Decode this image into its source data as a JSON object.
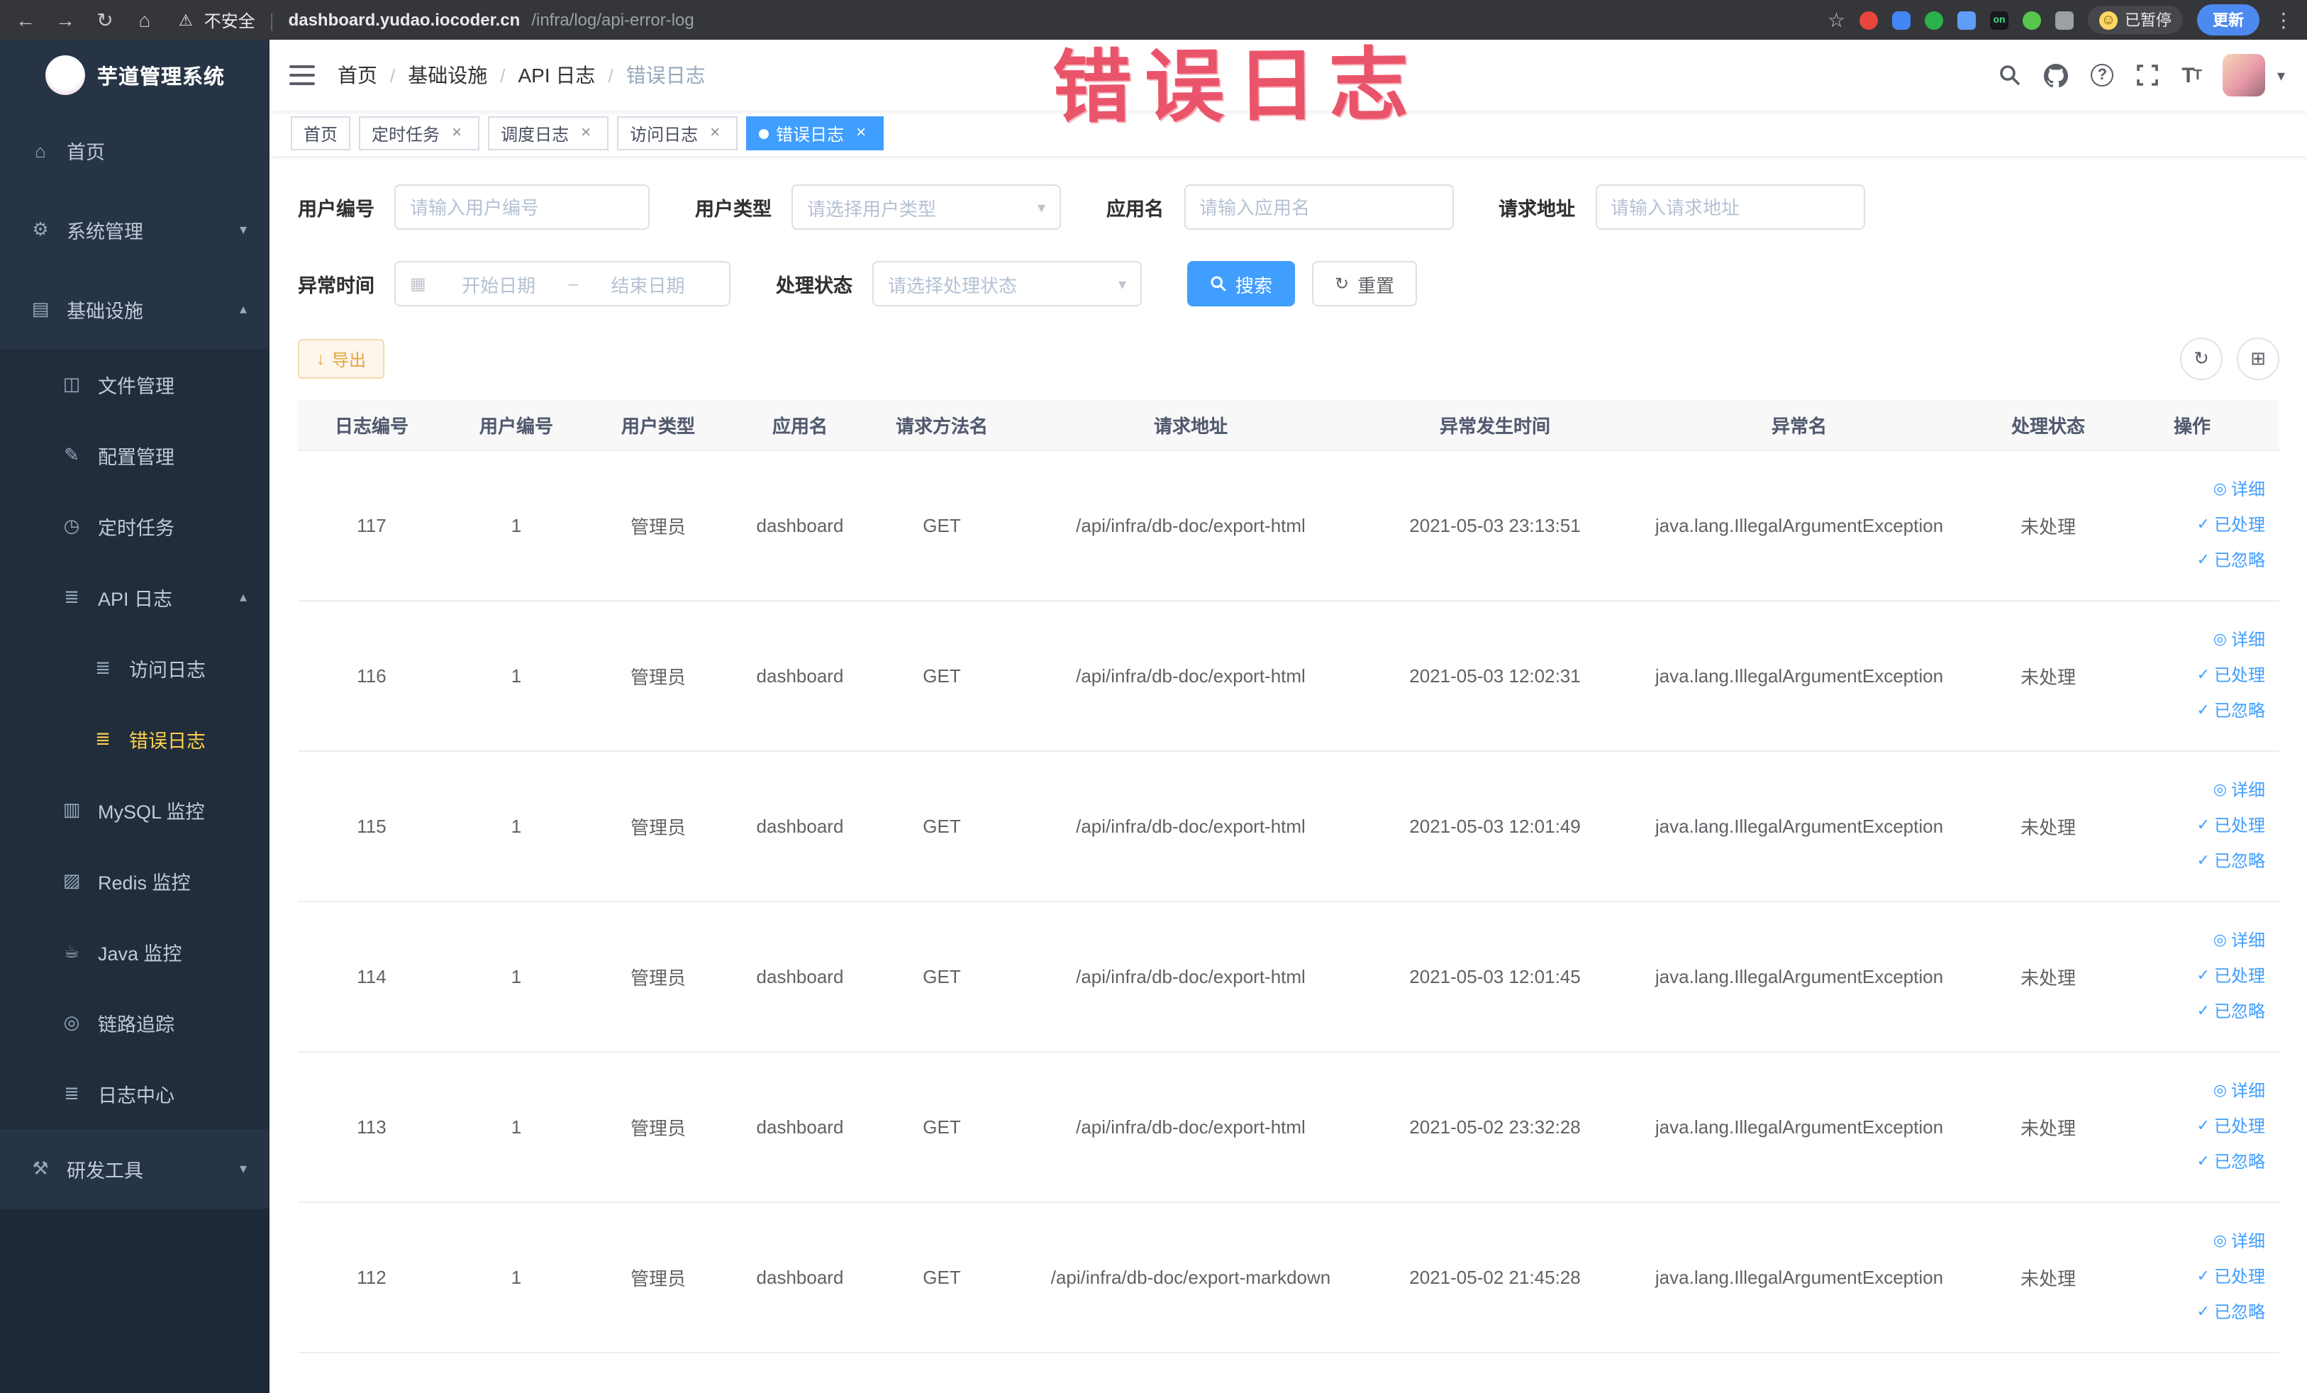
{
  "colors": {
    "accent": "#409eff",
    "warning_text": "#e6a23c",
    "sidebar_active_text": "#ffd04b",
    "watermark": "#e9485f",
    "link": "#409eff"
  },
  "icons": {
    "back": "←",
    "forward": "→",
    "reload": "↻",
    "home": "⌂",
    "warning": "⚠",
    "star": "☆",
    "kebab": "⋮",
    "divider": "|",
    "extension_on_text": "on",
    "smiley": "☺",
    "caret_down": "▾",
    "chevron_down": "▾",
    "chevron_up": "▴",
    "select_caret": "▾",
    "menu_home": "⌂",
    "menu_system": "⚙",
    "menu_infra": "▤",
    "menu_file": "◫",
    "menu_config": "✎",
    "menu_job": "◷",
    "menu_api": "≣",
    "menu_doc": "≣",
    "menu_mysql": "▥",
    "menu_redis": "▨",
    "menu_java": "☕",
    "menu_trace": "◎",
    "menu_log": "≣",
    "menu_tool": "⚒",
    "calendar": "▦",
    "range_sep": "–",
    "export": "↓",
    "refresh": "↻",
    "columns": "⊞",
    "eye": "◎",
    "check": "✓",
    "close": "×",
    "question": "?",
    "fontsize_big": "T",
    "fontsize_small": "T"
  },
  "browser": {
    "security_label": "不安全",
    "url_host": "dashboard.yudao.iocoder.cn",
    "url_path": "/infra/log/api-error-log",
    "paused_badge": "已暂停",
    "update_button": "更新"
  },
  "watermark": "错误日志",
  "sidebar": {
    "logo_title": "芋道管理系统",
    "items": [
      {
        "label": "首页"
      },
      {
        "label": "系统管理"
      },
      {
        "label": "基础设施"
      },
      {
        "label": "文件管理"
      },
      {
        "label": "配置管理"
      },
      {
        "label": "定时任务"
      },
      {
        "label": "API 日志"
      },
      {
        "label": "访问日志"
      },
      {
        "label": "错误日志"
      },
      {
        "label": "MySQL 监控"
      },
      {
        "label": "Redis 监控"
      },
      {
        "label": "Java 监控"
      },
      {
        "label": "链路追踪"
      },
      {
        "label": "日志中心"
      },
      {
        "label": "研发工具"
      }
    ]
  },
  "breadcrumb": {
    "separator": "/",
    "items": [
      "首页",
      "基础设施",
      "API 日志",
      "错误日志"
    ]
  },
  "tags": [
    {
      "label": "首页"
    },
    {
      "label": "定时任务"
    },
    {
      "label": "调度日志"
    },
    {
      "label": "访问日志"
    },
    {
      "label": "错误日志"
    }
  ],
  "filters": {
    "user_id": {
      "label": "用户编号",
      "placeholder": "请输入用户编号",
      "value": ""
    },
    "user_type": {
      "label": "用户类型",
      "placeholder": "请选择用户类型"
    },
    "app_name": {
      "label": "应用名",
      "placeholder": "请输入应用名",
      "value": ""
    },
    "request_url": {
      "label": "请求地址",
      "placeholder": "请输入请求地址",
      "value": ""
    },
    "exception_time": {
      "label": "异常时间",
      "start_placeholder": "开始日期",
      "end_placeholder": "结束日期"
    },
    "process_status": {
      "label": "处理状态",
      "placeholder": "请选择处理状态"
    },
    "search_button": "搜索",
    "reset_button": "重置"
  },
  "toolbar": {
    "export_button": "导出"
  },
  "table": {
    "columns": [
      "日志编号",
      "用户编号",
      "用户类型",
      "应用名",
      "请求方法名",
      "请求地址",
      "异常发生时间",
      "异常名",
      "处理状态",
      "操作"
    ],
    "actions": {
      "detail": "详细",
      "processed": "已处理",
      "ignored": "已忽略"
    },
    "rows": [
      {
        "log_id": "117",
        "user_id": "1",
        "user_type": "管理员",
        "app_name": "dashboard",
        "method": "GET",
        "url": "/api/infra/db-doc/export-html",
        "time": "2021-05-03 23:13:51",
        "exception": "java.lang.IllegalArgumentException",
        "status": "未处理"
      },
      {
        "log_id": "116",
        "user_id": "1",
        "user_type": "管理员",
        "app_name": "dashboard",
        "method": "GET",
        "url": "/api/infra/db-doc/export-html",
        "time": "2021-05-03 12:02:31",
        "exception": "java.lang.IllegalArgumentException",
        "status": "未处理"
      },
      {
        "log_id": "115",
        "user_id": "1",
        "user_type": "管理员",
        "app_name": "dashboard",
        "method": "GET",
        "url": "/api/infra/db-doc/export-html",
        "time": "2021-05-03 12:01:49",
        "exception": "java.lang.IllegalArgumentException",
        "status": "未处理"
      },
      {
        "log_id": "114",
        "user_id": "1",
        "user_type": "管理员",
        "app_name": "dashboard",
        "method": "GET",
        "url": "/api/infra/db-doc/export-html",
        "time": "2021-05-03 12:01:45",
        "exception": "java.lang.IllegalArgumentException",
        "status": "未处理"
      },
      {
        "log_id": "113",
        "user_id": "1",
        "user_type": "管理员",
        "app_name": "dashboard",
        "method": "GET",
        "url": "/api/infra/db-doc/export-html",
        "time": "2021-05-02 23:32:28",
        "exception": "java.lang.IllegalArgumentException",
        "status": "未处理"
      },
      {
        "log_id": "112",
        "user_id": "1",
        "user_type": "管理员",
        "app_name": "dashboard",
        "method": "GET",
        "url": "/api/infra/db-doc/export-markdown",
        "time": "2021-05-02 21:45:28",
        "exception": "java.lang.IllegalArgumentException",
        "status": "未处理"
      }
    ]
  }
}
